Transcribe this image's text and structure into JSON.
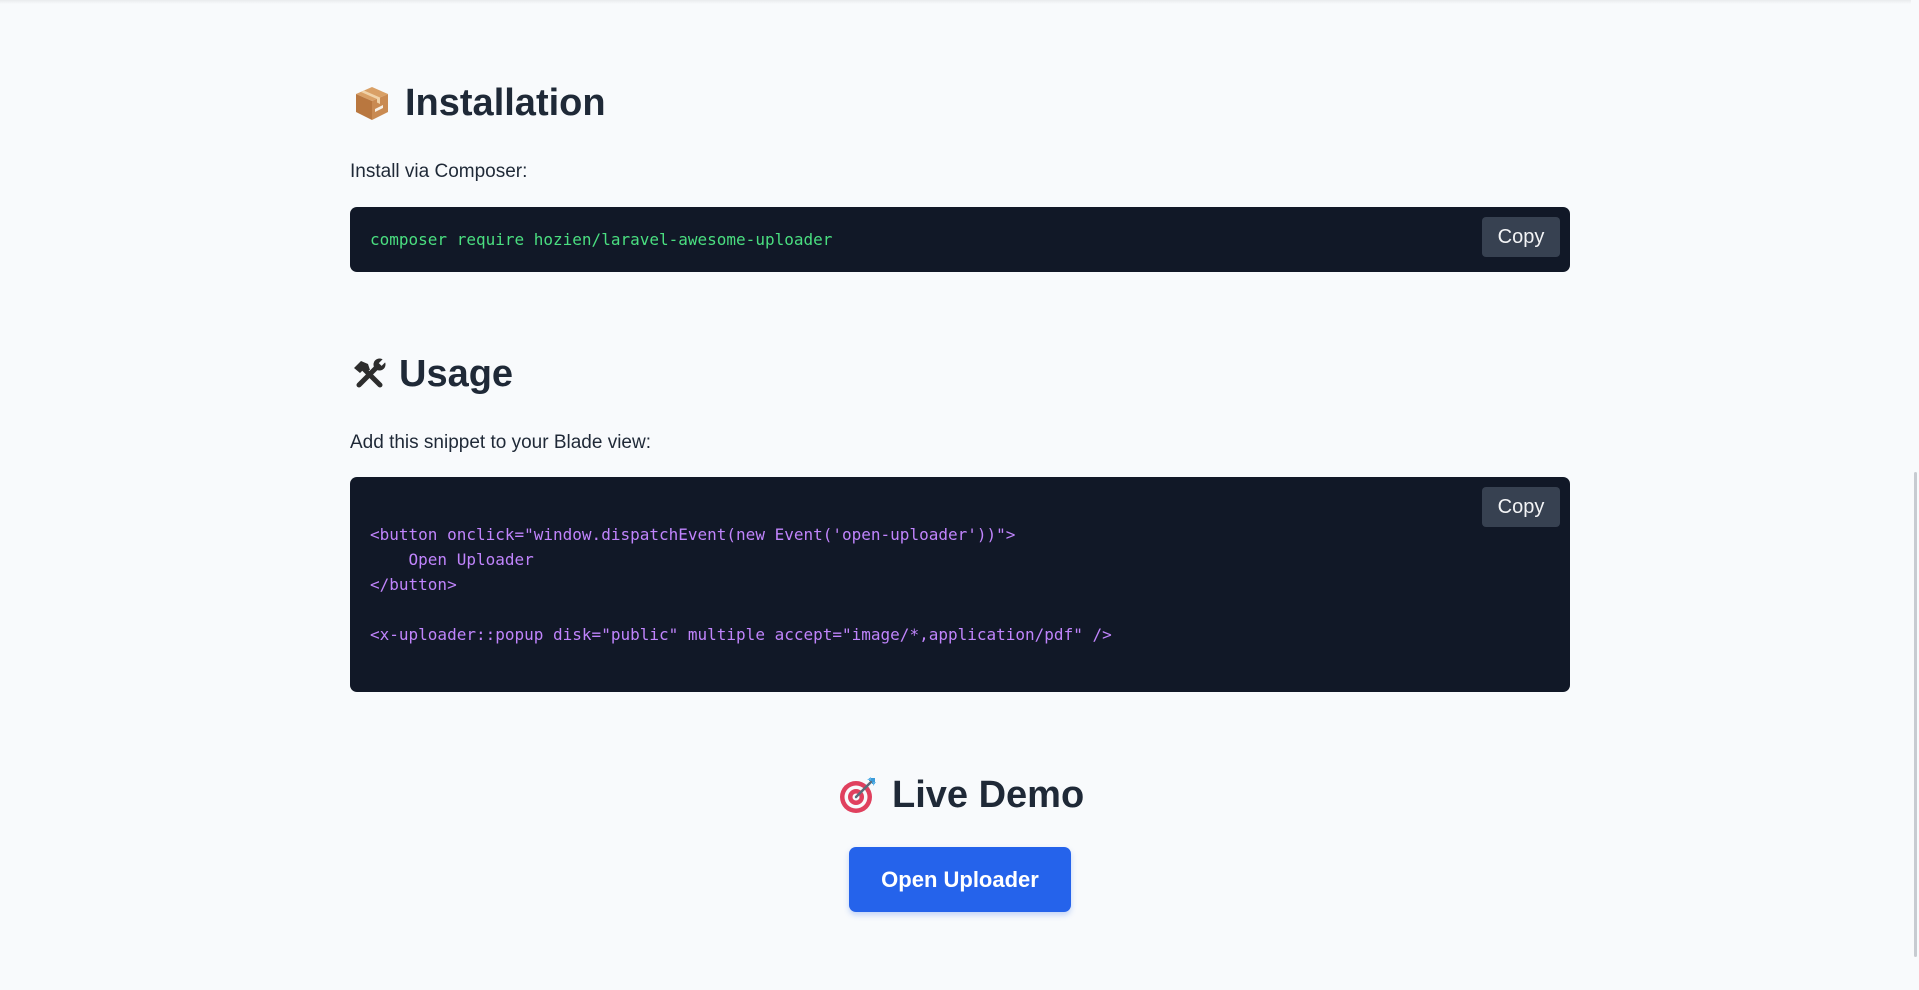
{
  "installation": {
    "title": "Installation",
    "icon": "package-icon",
    "intro": "Install via Composer:",
    "code": "composer require hozien/laravel-awesome-uploader",
    "copy_label": "Copy"
  },
  "usage": {
    "title": "Usage",
    "icon": "hammer-wrench-icon",
    "intro": "Add this snippet to your Blade view:",
    "code": "<button onclick=\"window.dispatchEvent(new Event('open-uploader'))\">\n    Open Uploader\n</button>\n\n<x-uploader::popup disk=\"public\" multiple accept=\"image/*,application/pdf\" />",
    "copy_label": "Copy"
  },
  "demo": {
    "title": "Live Demo",
    "icon": "target-icon",
    "button_label": "Open Uploader"
  },
  "colors": {
    "background": "#f8fafc",
    "code_bg": "#111827",
    "code_green": "#4ade80",
    "code_purple": "#c084fc",
    "accent": "#2563eb",
    "copy_bg": "#374151"
  }
}
